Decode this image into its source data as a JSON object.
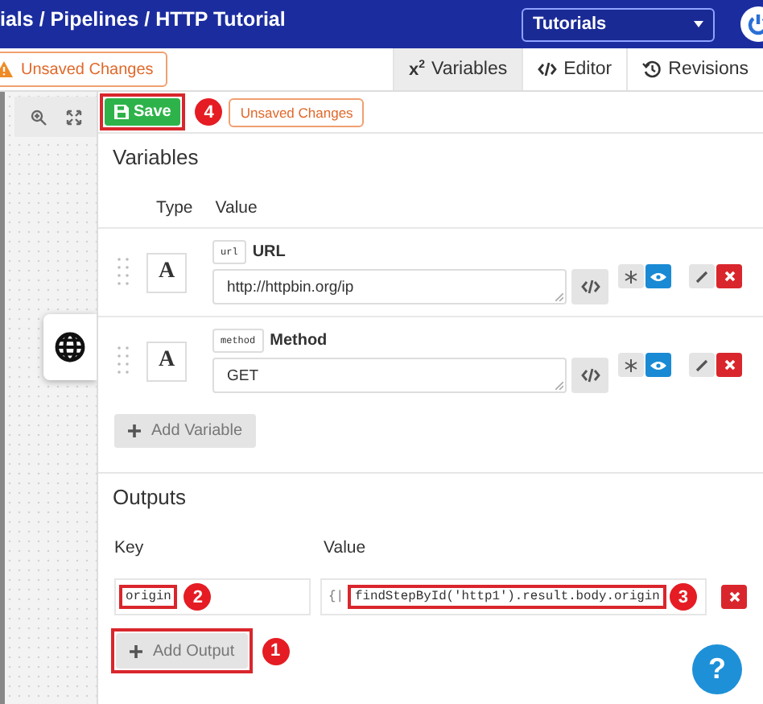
{
  "header": {
    "breadcrumb": "ials / Pipelines / HTTP Tutorial",
    "project_select": "Tutorials"
  },
  "status_badge": "Unsaved Changes",
  "tabs": [
    {
      "kind": "superscript",
      "icon_text": "x$^{2}$",
      "label": "Variables",
      "selected": true
    },
    {
      "kind": "code",
      "label": "Editor",
      "selected": false
    },
    {
      "kind": "history",
      "label": "Revisions",
      "selected": false
    }
  ],
  "toolbar": {
    "save": {
      "label": "Save",
      "highlighted": true,
      "marker": "4"
    },
    "status": "Unsaved Changes"
  },
  "variables": {
    "title": "Variables",
    "columns": [
      "Type",
      "Value"
    ],
    "rows": [
      {
        "type_glyph": "A",
        "key": "url",
        "label": "URL",
        "value": "http://httpbin.org/ip",
        "secret": false,
        "visible": true
      },
      {
        "type_glyph": "A",
        "key": "method",
        "label": "Method",
        "value": "GET",
        "secret": false,
        "visible": true
      }
    ],
    "add_button": "Add Variable"
  },
  "outputs": {
    "title": "Outputs",
    "columns": [
      "Key",
      "Value"
    ],
    "rows": [
      {
        "key": "origin",
        "key_highlighted": true,
        "key_marker": "2",
        "prefix": "{|",
        "value": "findStepById('http1').result.body.origin",
        "value_highlighted": true,
        "value_marker": "3"
      }
    ],
    "add_button": {
      "label": "Add Output",
      "highlighted": true,
      "marker": "1"
    }
  },
  "help": "?"
}
